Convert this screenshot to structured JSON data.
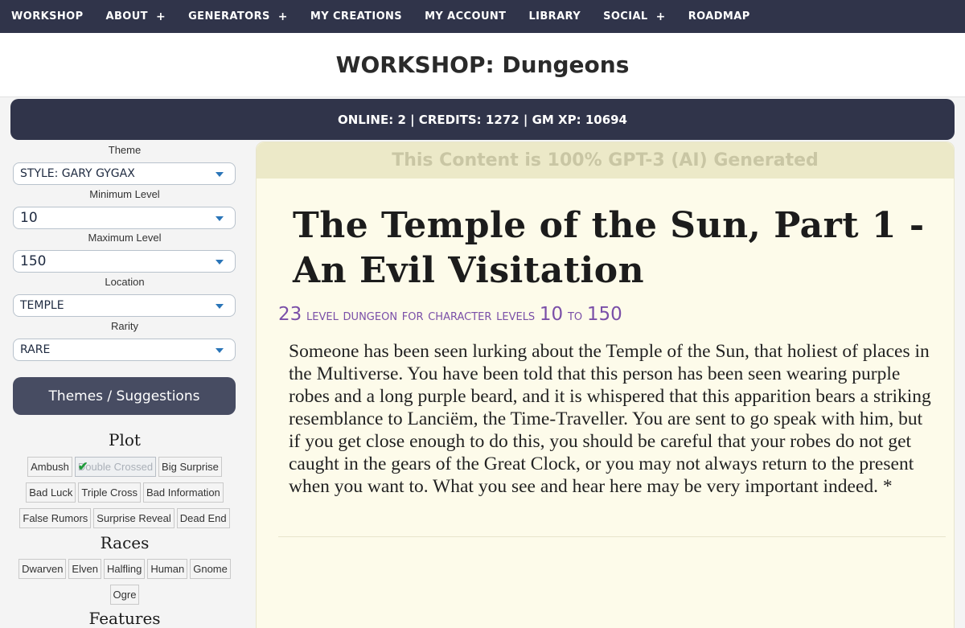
{
  "nav": {
    "items": [
      {
        "label": "WORKSHOP",
        "plus": ""
      },
      {
        "label": "ABOUT",
        "plus": "+"
      },
      {
        "label": "GENERATORS",
        "plus": "+"
      },
      {
        "label": "MY CREATIONS",
        "plus": ""
      },
      {
        "label": "MY ACCOUNT",
        "plus": ""
      },
      {
        "label": "LIBRARY",
        "plus": ""
      },
      {
        "label": "SOCIAL",
        "plus": "+"
      },
      {
        "label": "ROADMAP",
        "plus": ""
      }
    ]
  },
  "header": {
    "title": "WORKSHOP: Dungeons"
  },
  "status": {
    "text": "ONLINE: 2 | CREDITS: 1272 | GM XP: 10694"
  },
  "sidebar": {
    "fields": [
      {
        "label": "Theme",
        "value": "STYLE: GARY GYGAX"
      },
      {
        "label": "Minimum Level",
        "value": "10"
      },
      {
        "label": "Maximum Level",
        "value": "150"
      },
      {
        "label": "Location",
        "value": "TEMPLE"
      },
      {
        "label": "Rarity",
        "value": "RARE"
      }
    ],
    "themes_button": "Themes / Suggestions",
    "sections": {
      "plot": "Plot",
      "races": "Races",
      "features": "Features"
    },
    "plot_tags": [
      [
        "Ambush",
        "Double Crossed",
        "Big Surprise"
      ],
      [
        "Bad Luck",
        "Triple Cross",
        "Bad Information"
      ],
      [
        "False Rumors",
        "Surprise Reveal",
        "Dead End"
      ]
    ],
    "race_tags": [
      [
        "Dwarven",
        "Elven",
        "Halfling",
        "Human",
        "Gnome"
      ],
      [
        "Ogre"
      ]
    ]
  },
  "main": {
    "ai_banner": "This Content is 100% GPT-3 (AI) Generated",
    "title": "The Temple of the Sun, Part 1 - An Evil Visitation",
    "subtitle": {
      "level": "23",
      "text1": "level dungeon for character levels",
      "min": "10",
      "to": "to",
      "max": "150"
    },
    "description": "Someone has been seen lurking about the Temple of the Sun, that holiest of places in the Multiverse. You have been told that this person has been seen wearing purple robes and a long purple beard, and it is whispered that this apparition bears a striking resemblance to Lanciëm, the Time-Traveller. You are sent to go speak with him, but if you get close enough to do this, you should be careful that your robes do not get caught in the gears of the Great Clock, or you may not always return to the present when you want to. What you see and hear here may be very important indeed. *"
  },
  "colors": {
    "nav_bg": "#30344a",
    "accent_purple": "#7a4fa8",
    "content_bg": "#fdfbea",
    "check_green": "#1f9a3a"
  }
}
